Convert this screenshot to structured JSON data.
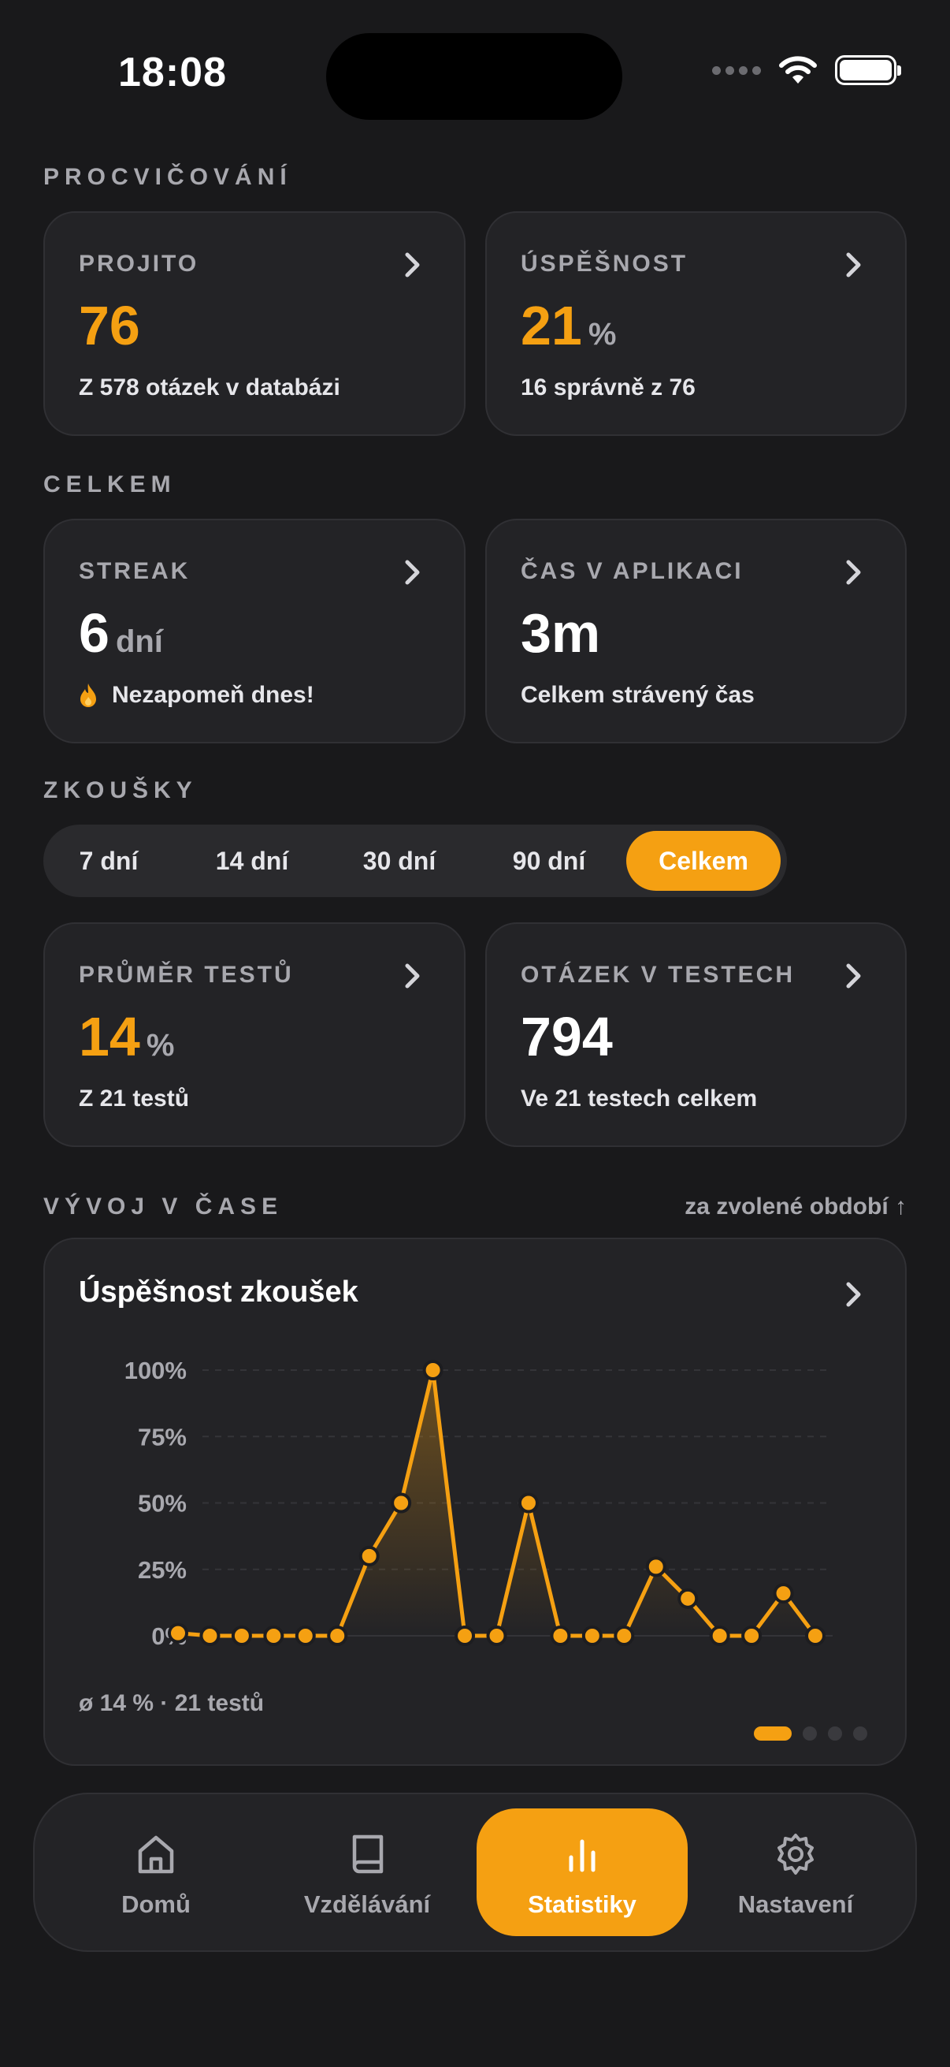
{
  "status": {
    "time": "18:08"
  },
  "sections": {
    "practice": "PROCVIČOVÁNÍ",
    "overall": "CELKEM",
    "exams": "ZKOUŠKY",
    "trend": "VÝVOJ V ČASE",
    "trend_period": "za zvolené období ↑"
  },
  "cards": {
    "projito": {
      "label": "PROJITO",
      "value": "76",
      "sub": "Z 578 otázek v databázi"
    },
    "uspesnost": {
      "label": "ÚSPĚŠNOST",
      "value": "21",
      "unit": "%",
      "sub": "16 správně z 76"
    },
    "streak": {
      "label": "STREAK",
      "value": "6",
      "unit": "dní",
      "sub": "Nezapomeň dnes!"
    },
    "cas": {
      "label": "ČAS V APLIKACI",
      "value": "3m",
      "sub": "Celkem strávený čas"
    },
    "prumer": {
      "label": "PRŮMĚR TESTŮ",
      "value": "14",
      "unit": "%",
      "sub": "Z 21 testů"
    },
    "otazek": {
      "label": "OTÁZEK V TESTECH",
      "value": "794",
      "sub": "Ve 21 testech celkem"
    }
  },
  "periods": [
    "7 dní",
    "14 dní",
    "30 dní",
    "90 dní",
    "Celkem"
  ],
  "active_period": "Celkem",
  "chart": {
    "title": "Úspěšnost zkoušek",
    "footer": "ø 14 % · 21 testů",
    "accent": "#f5a012"
  },
  "chart_data": {
    "type": "line",
    "y_ticks": [
      "100%",
      "75%",
      "50%",
      "25%",
      "0%"
    ],
    "ylim": [
      0,
      100
    ],
    "x": [
      1,
      2,
      3,
      4,
      5,
      6,
      7,
      8,
      9,
      10,
      11,
      12,
      13,
      14,
      15,
      16,
      17,
      18,
      19,
      20,
      21
    ],
    "values": [
      1,
      0,
      0,
      0,
      0,
      0,
      30,
      50,
      100,
      0,
      0,
      50,
      0,
      0,
      0,
      26,
      14,
      0,
      0,
      16,
      0
    ],
    "grid": true
  },
  "nav": [
    {
      "label": "Domů",
      "icon": "home-icon"
    },
    {
      "label": "Vzdělávání",
      "icon": "book-icon"
    },
    {
      "label": "Statistiky",
      "icon": "bar-chart-icon"
    },
    {
      "label": "Nastavení",
      "icon": "gear-icon"
    }
  ]
}
